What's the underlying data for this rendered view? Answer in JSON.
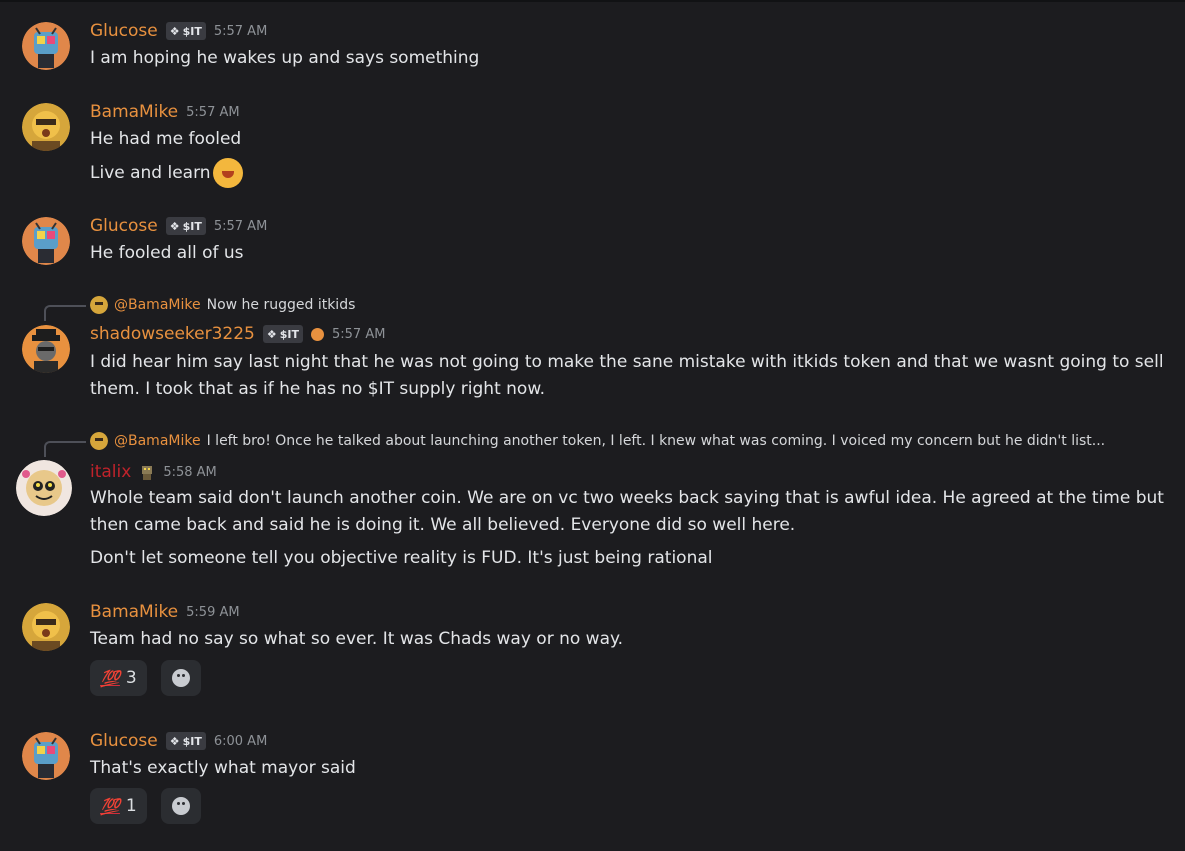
{
  "messages": [
    {
      "user": "Glucose",
      "tag": "$IT",
      "time": "5:57 AM",
      "lines": [
        "I am hoping he wakes up and says something"
      ]
    },
    {
      "user": "BamaMike",
      "time": "5:57 AM",
      "lines": [
        "He had me fooled",
        "Live and learn"
      ]
    },
    {
      "user": "Glucose",
      "tag": "$IT",
      "time": "5:57 AM",
      "lines": [
        "He fooled all of us"
      ]
    },
    {
      "reply": {
        "mention": "@BamaMike",
        "text": "Now he rugged itkids"
      },
      "user": "shadowseeker3225",
      "tag": "$IT",
      "time": "5:57 AM",
      "lines": [
        "I did hear him say last night that he was not going to make the sane mistake with itkids token and that we wasnt going to sell",
        "them. I took that as if he has no $IT supply right now."
      ]
    },
    {
      "reply": {
        "mention": "@BamaMike",
        "text": "I left bro! Once he talked about launching another token, I left. I knew what was coming. I voiced my concern but he didn't list..."
      },
      "user": "italix",
      "time": "5:58 AM",
      "lines": [
        "Whole team said don't launch another coin. We are on vc two weeks back saying that is awful idea. He agreed at the time but",
        "then came back and said he is doing it. We all believed. Everyone did so well here.",
        "Don't let someone tell you objective reality is FUD. It's just being rational"
      ]
    },
    {
      "user": "BamaMike",
      "time": "5:59 AM",
      "lines": [
        "Team had no say so what so ever. It was Chads way or no way."
      ],
      "reaction": {
        "emoji": "💯",
        "count": "3"
      }
    },
    {
      "user": "Glucose",
      "tag": "$IT",
      "time": "6:00 AM",
      "lines": [
        "That's exactly what mayor said"
      ],
      "reaction": {
        "emoji": "💯",
        "count": "1"
      }
    }
  ],
  "colors": {
    "background": "#1c1c1f",
    "username_orange": "#e8913f",
    "username_red": "#c0232b",
    "timestamp": "#8e9297"
  },
  "icons": [
    "avatar-glucose",
    "avatar-bamamike",
    "avatar-shadowseeker",
    "avatar-italix",
    "diamond-icon",
    "hundred-emoji",
    "add-reaction-icon",
    "smiling-emoji"
  ]
}
